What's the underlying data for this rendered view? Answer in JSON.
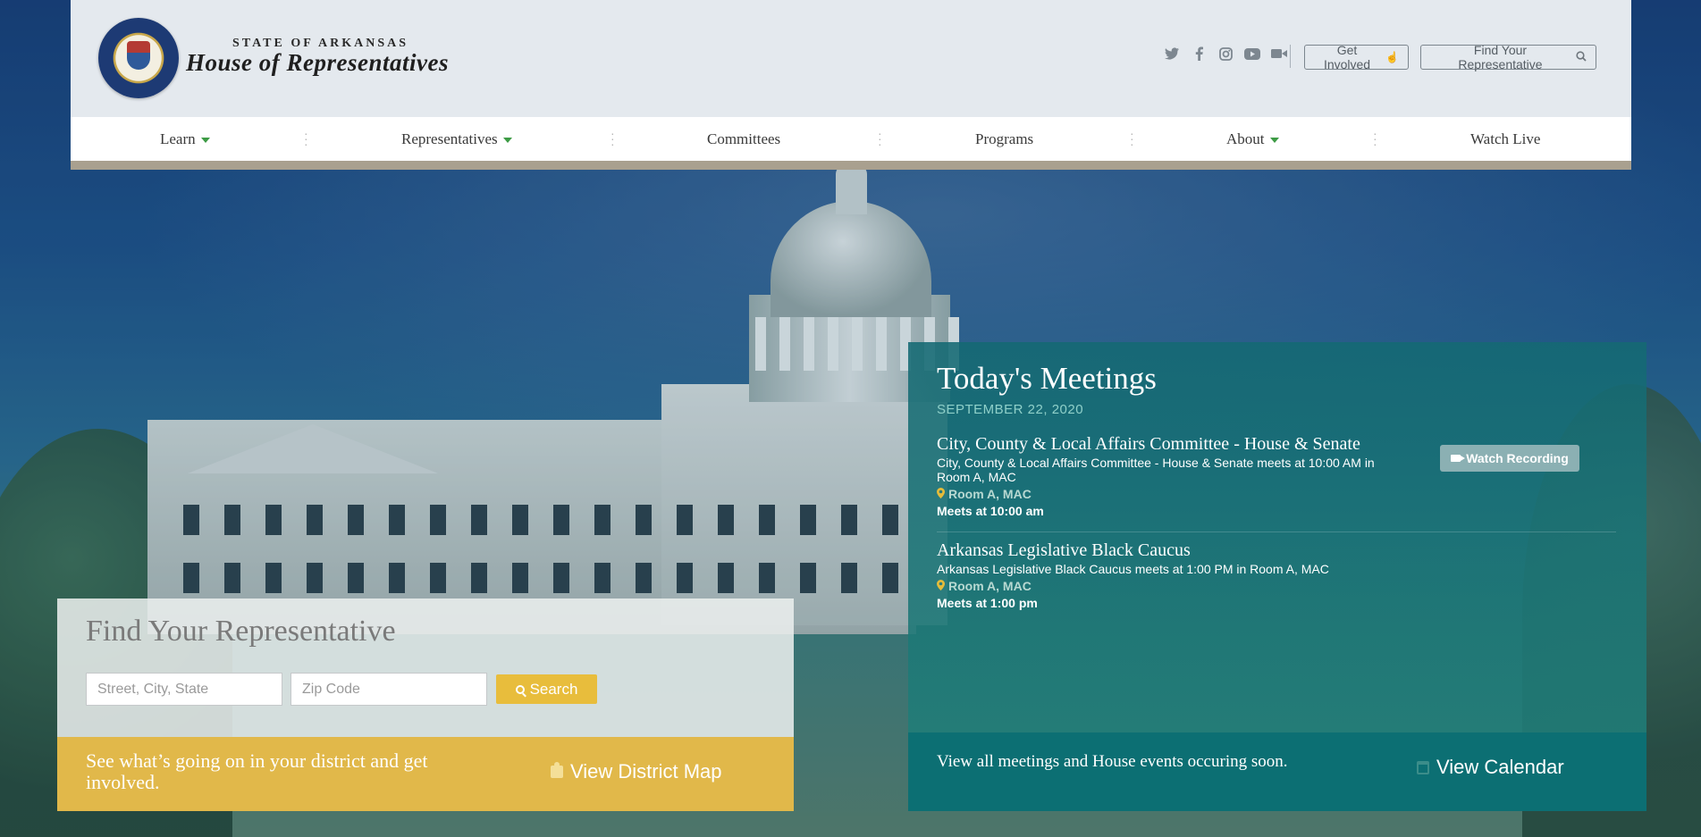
{
  "header": {
    "state_label": "STATE OF ARKANSAS",
    "title": "House of Representatives",
    "social_icons": [
      "twitter-icon",
      "facebook-icon",
      "instagram-icon",
      "youtube-icon",
      "video-icon"
    ],
    "get_involved_label": "Get Involved",
    "find_rep_label": "Find Your Representative"
  },
  "nav": {
    "items": [
      {
        "label": "Learn",
        "dropdown": true
      },
      {
        "label": "Representatives",
        "dropdown": true
      },
      {
        "label": "Committees",
        "dropdown": false
      },
      {
        "label": "Programs",
        "dropdown": false
      },
      {
        "label": "About",
        "dropdown": true
      },
      {
        "label": "Watch Live",
        "dropdown": false
      }
    ]
  },
  "meetings": {
    "title": "Today's Meetings",
    "date": "SEPTEMBER 22, 2020",
    "watch_recording_label": "Watch Recording",
    "items": [
      {
        "name": "City, County & Local Affairs Committee - House & Senate",
        "description": "City, County & Local Affairs Committee - House & Senate meets at 10:00 AM in Room A, MAC",
        "room": "Room A, MAC",
        "time": "Meets at 10:00 am"
      },
      {
        "name": "Arkansas Legislative Black Caucus",
        "description": "Arkansas Legislative Black Caucus meets at 1:00 PM in Room A, MAC",
        "room": "Room A, MAC",
        "time": "Meets at 1:00 pm"
      }
    ],
    "calendar_text": "View all meetings and House events occuring soon.",
    "calendar_link": "View Calendar"
  },
  "find_rep": {
    "title": "Find Your Representative",
    "address_placeholder": "Street, City, State",
    "zip_placeholder": "Zip Code",
    "search_label": "Search"
  },
  "district": {
    "text": "See what’s going on in your district and get involved.",
    "link": "View District Map"
  },
  "colors": {
    "accent_green": "#3d9b45",
    "gold": "#e1b84a",
    "teal": "#0c6f73",
    "header_bg": "#e4e9ee"
  }
}
